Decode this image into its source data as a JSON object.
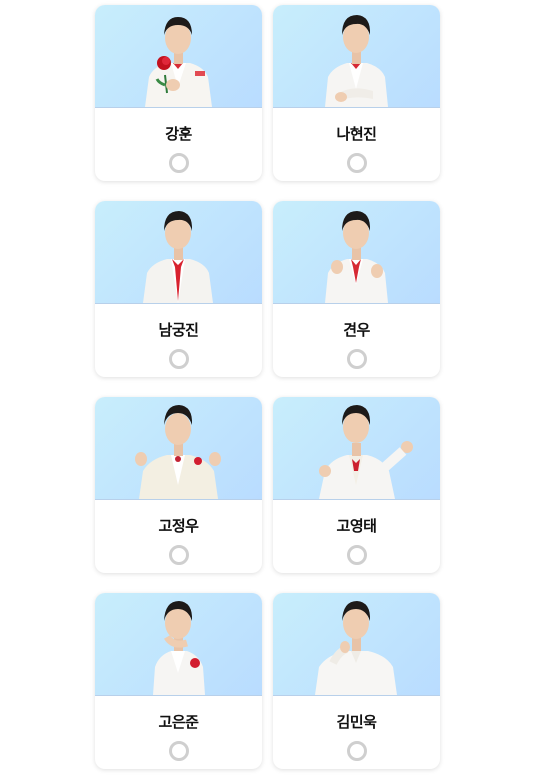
{
  "candidates": [
    {
      "name": "강훈",
      "pose": "rose",
      "selected": false
    },
    {
      "name": "나현진",
      "pose": "hands",
      "selected": false
    },
    {
      "name": "남궁진",
      "pose": "tie",
      "selected": false
    },
    {
      "name": "견우",
      "pose": "heart",
      "selected": false
    },
    {
      "name": "고정우",
      "pose": "heart-wide",
      "selected": false
    },
    {
      "name": "고영태",
      "pose": "point",
      "selected": false
    },
    {
      "name": "고은준",
      "pose": "chin",
      "selected": false
    },
    {
      "name": "김민욱",
      "pose": "shoulder",
      "selected": false
    }
  ]
}
